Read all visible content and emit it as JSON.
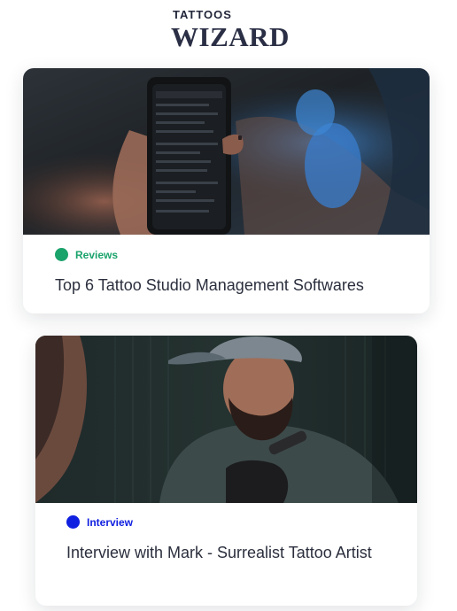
{
  "brand": {
    "top": "TATTOOS",
    "bottom": "WIZARD"
  },
  "cards": [
    {
      "category": "Reviews",
      "category_color": "#1aa36b",
      "title": "Top 6 Tattoo Studio Management Softwares",
      "image_icon": "phone-in-hand-photo"
    },
    {
      "category": "Interview",
      "category_color": "#1020e0",
      "title": "Interview with Mark - Surrealist Tattoo Artist",
      "image_icon": "tattoo-artist-photo"
    }
  ]
}
